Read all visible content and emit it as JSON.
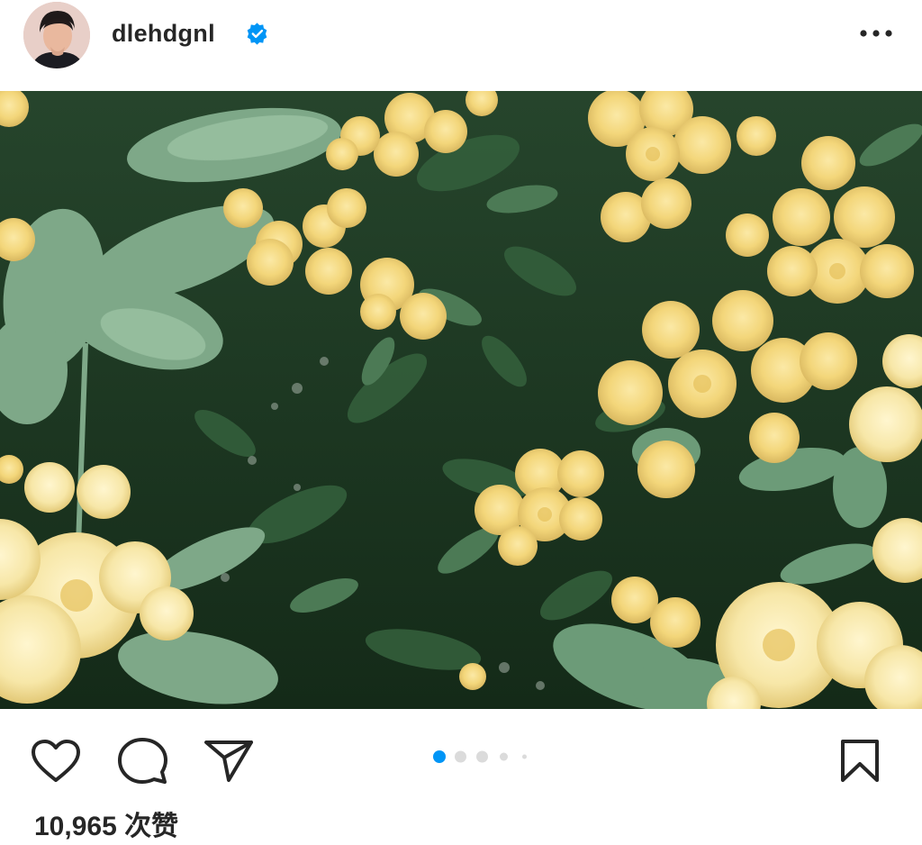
{
  "post": {
    "username": "dlehdgnl",
    "likes_text": "10,965 次赞"
  },
  "icons": {
    "avatar": "profile-photo",
    "verified": "verified-badge-icon",
    "more": "more-options-icon",
    "like": "heart-icon",
    "comment": "comment-bubble-icon",
    "share": "paper-plane-icon",
    "save": "bookmark-icon"
  },
  "carousel": {
    "total_dots": 5,
    "active_index": 0
  },
  "colors": {
    "accent_blue": "#0095f6",
    "dot_inactive": "#dbdbdb",
    "text": "#262626",
    "flower_yellow": "#f3d979",
    "leaf_green": "#4f7c58"
  }
}
